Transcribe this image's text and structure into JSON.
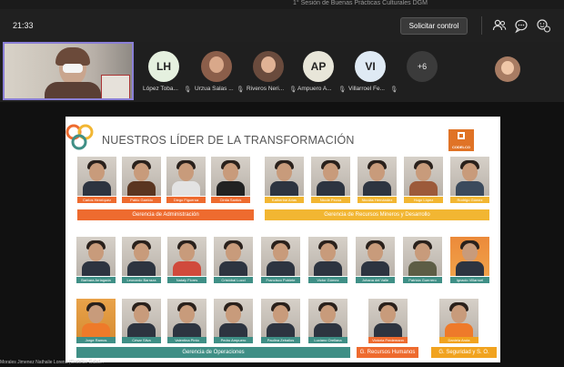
{
  "window": {
    "meeting_title": "1° Sesión de Buenas Prácticas Culturales DGM"
  },
  "toolbar": {
    "time": "21:33",
    "request_control_label": "Solicitar control",
    "icons": [
      "people-icon",
      "chat-icon",
      "reactions-icon"
    ]
  },
  "participants": [
    {
      "initials": "LH",
      "name": "López Toba...",
      "color": "#e5f0df"
    },
    {
      "initials": "",
      "name": "Urzua Salas ...",
      "color": "#8b5e4a"
    },
    {
      "initials": "",
      "name": "Riveros Neri...",
      "color": "#6a4b3d"
    },
    {
      "initials": "AP",
      "name": "Ampuero A...",
      "color": "#e8e6d9"
    },
    {
      "initials": "VI",
      "name": "Villarroel Fe...",
      "color": "#dfeaf4"
    }
  ],
  "more_participants": "+6",
  "slide": {
    "title": "NUESTROS LÍDER DE LA TRANSFORMACIÓN",
    "logo_text": "CODELCO",
    "colors": {
      "orange": "#ee6b2f",
      "yellow": "#f2b632",
      "teal": "#3f8f86",
      "gold": "#f1a31f"
    },
    "groups": {
      "admin": {
        "label": "Gerencia de Administración",
        "people": [
          "Carlos Henríquez",
          "Pablo Garrido",
          "Diego Figueroa",
          "Cintia Santos"
        ]
      },
      "recursos_mineros": {
        "label": "Gerencia de Recursos Mineros y Desarrollo",
        "people": [
          "Katherine Arias",
          "Nicole Pezoa",
          "Nicolás Hernández",
          "Hugo López",
          "Rodrigo Gómez"
        ]
      },
      "row2": {
        "people": [
          "Barbara Arriagada",
          "Leonardo Barraza",
          "Nataly Flores",
          "Cristóbal Lucci",
          "Francisco Poblete",
          "Victor Gómez",
          "Johana del Valle",
          "Patricia Guerrero",
          "Ignacio Villarroel"
        ]
      },
      "row3": {
        "people": [
          "Jorge Ramos",
          "César Silva",
          "Valentina Pinto",
          "Pedro Ampuero",
          "Paulina Zeballos",
          "Luciano Orellana"
        ]
      },
      "operaciones": {
        "label": "Gerencia de Operaciones"
      },
      "rrhh": {
        "label": "G. Recursos Humanos",
        "people": [
          "Victoria Fredemann"
        ]
      },
      "seguridad": {
        "label": "G. Seguridad y S. O.",
        "people": [
          "Daniela Aruta"
        ]
      }
    }
  },
  "presenter_label": "Morales Jimenez Nathalie Lorena (Codelco-Gabd..."
}
